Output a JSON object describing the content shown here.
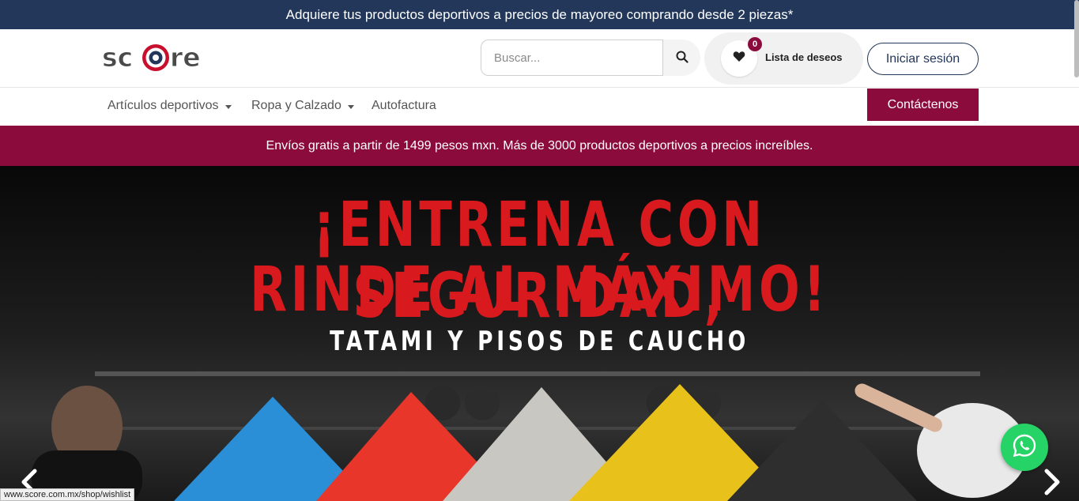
{
  "announcement": {
    "text": "Adquiere tus productos deportivos a precios de mayoreo comprando desde 2 piezas*"
  },
  "header": {
    "logo_text": "score",
    "search": {
      "placeholder": "Buscar..."
    },
    "wishlist": {
      "label": "Lista de deseos",
      "count": "0"
    },
    "login_label": "Iniciar sesión"
  },
  "nav": {
    "items": [
      {
        "label": "Artículos deportivos",
        "dropdown": true
      },
      {
        "label": "Ropa y Calzado",
        "dropdown": true
      },
      {
        "label": "Autofactura",
        "dropdown": false
      }
    ],
    "contact_label": "Contáctenos"
  },
  "promo": {
    "text": "Envíos gratis a partir de 1499 pesos mxn.  Más de 3000 productos deportivos a precios increíbles."
  },
  "hero": {
    "title_line1": "¡ENTRENA CON SEGURIDAD,",
    "title_line2": "RINDE AL MÁXIMO!",
    "subtitle": "TATAMI Y PISOS DE CAUCHO",
    "prev_icon": "chevron-left-icon",
    "next_icon": "chevron-right-icon"
  },
  "status_bar": {
    "url": "www.score.com.mx/shop/wishlist"
  },
  "colors": {
    "announce_bg": "#22375a",
    "brand": "#8c0b3d",
    "hero_title": "#d8191e",
    "whatsapp": "#25d366"
  },
  "icons": {
    "search": "search-icon",
    "wishlist": "heart-icon",
    "whatsapp": "whatsapp-icon"
  }
}
